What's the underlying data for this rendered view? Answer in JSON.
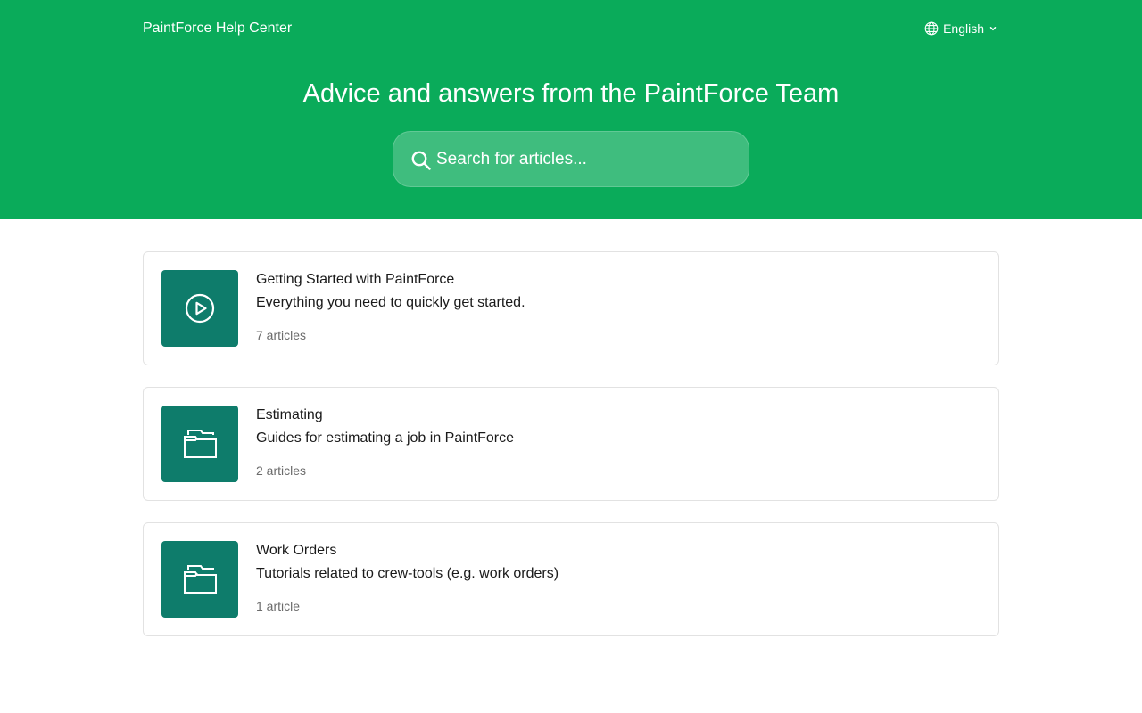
{
  "header": {
    "brand": "PaintForce Help Center",
    "language": "English",
    "hero_title": "Advice and answers from the PaintForce Team"
  },
  "search": {
    "placeholder": "Search for articles..."
  },
  "collections": [
    {
      "title": "Getting Started with PaintForce",
      "description": "Everything you need to quickly get started.",
      "count": "7 articles",
      "icon": "play-circle-icon"
    },
    {
      "title": "Estimating",
      "description": "Guides for estimating a job in PaintForce",
      "count": "2 articles",
      "icon": "folder-icon"
    },
    {
      "title": "Work Orders",
      "description": "Tutorials related to crew-tools (e.g. work orders)",
      "count": "1 article",
      "icon": "folder-icon"
    }
  ],
  "colors": {
    "header_bg": "#0aab5a",
    "icon_tile_bg": "#0e7c6b",
    "text_primary": "#1a1a1a",
    "text_muted": "#6b6b6b"
  }
}
